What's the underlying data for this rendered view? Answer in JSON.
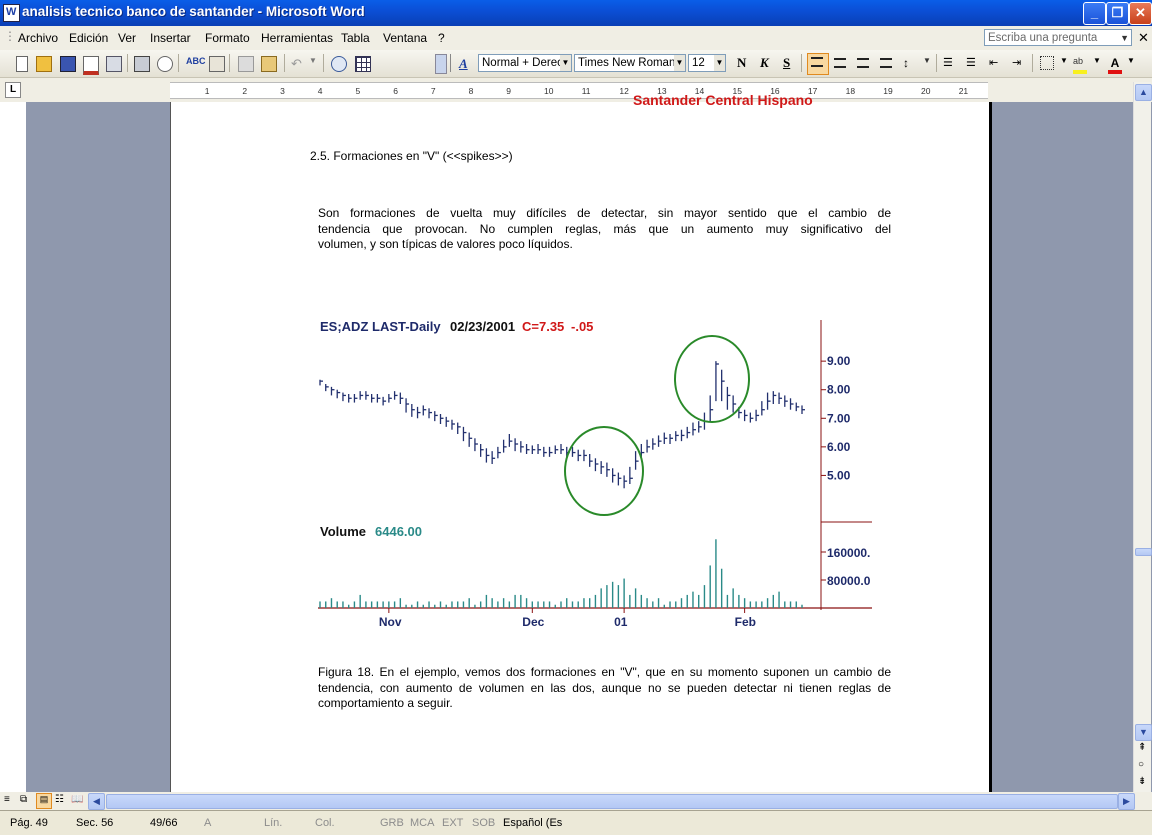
{
  "window": {
    "title": "analisis tecnico banco de santander - Microsoft Word"
  },
  "menu": {
    "items": [
      "Archivo",
      "Edición",
      "Ver",
      "Insertar",
      "Formato",
      "Herramientas",
      "Tabla",
      "Ventana",
      "?"
    ],
    "ask_placeholder": "Escriba una pregunta"
  },
  "toolbar": {
    "style": "Normal + Derec",
    "font": "Times New Roman",
    "size": "12",
    "bold": "N",
    "italic": "K",
    "strike": "S"
  },
  "ruler": {
    "numbers": [
      "1",
      "2",
      "3",
      "4",
      "5",
      "6",
      "7",
      "8",
      "9",
      "10",
      "11",
      "12",
      "13",
      "14",
      "15",
      "16",
      "17",
      "18",
      "19",
      "20",
      "21"
    ]
  },
  "document": {
    "header_fragment": "Santander Central Hispano",
    "heading": "2.5. Formaciones en \"V\" (<<spikes>>)",
    "para1_lines": [
      "Son formaciones de vuelta muy difíciles de detectar, sin mayor sentido que el cambio de",
      "tendencia que provocan.    No cumplen reglas, más que un aumento muy significativo del",
      "volumen, y son típicas de valores poco líquidos."
    ],
    "caption_lines": [
      "Figura 18. En el ejemplo, vemos dos formaciones en \"V\", que en su momento suponen un cambio de",
      "tendencia, con aumento de volumen en las dos, aunque no se pueden detectar ni tienen reglas de",
      "comportamiento a seguir."
    ]
  },
  "chart_data": {
    "type": "bar",
    "title": "ES;ADZ LAST-Daily",
    "date": "02/23/2001",
    "close_label": "C=7.35",
    "change_label": "-.05",
    "price_ticks": [
      "9.00",
      "8.00",
      "7.00",
      "6.00",
      "5.00"
    ],
    "ylim": [
      4.0,
      9.6
    ],
    "volume_title": "Volume",
    "volume_value": "6446.00",
    "volume_ticks": [
      "160000.",
      "80000.0"
    ],
    "x_labels": [
      "Nov",
      "Dec",
      "01",
      "Feb"
    ],
    "colors": {
      "price": "#22306e",
      "volume": "#2a8a88",
      "circle": "#2a8a2a",
      "title": "#1e2a6a",
      "close": "#d01818"
    },
    "price_close": [
      8.3,
      8.1,
      8.0,
      7.9,
      7.8,
      7.7,
      7.7,
      7.8,
      7.8,
      7.7,
      7.7,
      7.6,
      7.7,
      7.8,
      7.7,
      7.5,
      7.3,
      7.2,
      7.3,
      7.2,
      7.1,
      7.0,
      6.9,
      6.8,
      6.7,
      6.5,
      6.3,
      6.1,
      5.9,
      5.7,
      5.6,
      5.8,
      6.0,
      6.2,
      6.1,
      6.0,
      5.9,
      5.9,
      5.9,
      5.8,
      5.8,
      5.9,
      5.9,
      5.8,
      5.8,
      5.7,
      5.7,
      5.5,
      5.4,
      5.3,
      5.2,
      5.0,
      4.9,
      4.8,
      4.9,
      5.5,
      5.8,
      6.0,
      6.1,
      6.2,
      6.3,
      6.3,
      6.4,
      6.4,
      6.5,
      6.6,
      6.7,
      6.9,
      7.3,
      8.9,
      8.3,
      7.8,
      7.5,
      7.2,
      7.1,
      7.0,
      7.1,
      7.3,
      7.6,
      7.8,
      7.7,
      7.6,
      7.5,
      7.4,
      7.3
    ],
    "price_high": [
      8.35,
      8.2,
      8.1,
      8.0,
      7.9,
      7.85,
      7.85,
      7.95,
      7.95,
      7.85,
      7.85,
      7.75,
      7.85,
      7.95,
      7.9,
      7.7,
      7.5,
      7.4,
      7.45,
      7.35,
      7.25,
      7.15,
      7.05,
      6.95,
      6.85,
      6.7,
      6.5,
      6.3,
      6.1,
      5.95,
      5.85,
      6.0,
      6.25,
      6.45,
      6.3,
      6.2,
      6.1,
      6.05,
      6.1,
      6.0,
      6.0,
      6.05,
      6.1,
      6.0,
      6.0,
      5.9,
      5.9,
      5.75,
      5.6,
      5.5,
      5.45,
      5.25,
      5.1,
      5.0,
      5.3,
      5.85,
      6.1,
      6.25,
      6.3,
      6.4,
      6.5,
      6.45,
      6.55,
      6.6,
      6.7,
      6.85,
      6.9,
      7.2,
      7.8,
      9.0,
      8.7,
      8.1,
      7.8,
      7.4,
      7.3,
      7.2,
      7.3,
      7.6,
      7.9,
      7.95,
      7.9,
      7.8,
      7.7,
      7.55,
      7.45
    ],
    "price_low": [
      8.15,
      7.95,
      7.8,
      7.7,
      7.6,
      7.55,
      7.55,
      7.65,
      7.65,
      7.55,
      7.55,
      7.45,
      7.55,
      7.65,
      7.5,
      7.2,
      7.05,
      7.0,
      7.1,
      7.0,
      6.9,
      6.8,
      6.7,
      6.6,
      6.45,
      6.2,
      6.0,
      5.85,
      5.65,
      5.45,
      5.4,
      5.6,
      5.8,
      6.0,
      5.85,
      5.8,
      5.75,
      5.75,
      5.75,
      5.65,
      5.65,
      5.75,
      5.75,
      5.65,
      5.65,
      5.5,
      5.5,
      5.3,
      5.15,
      5.05,
      4.95,
      4.75,
      4.65,
      4.55,
      4.7,
      5.2,
      5.6,
      5.8,
      5.9,
      6.0,
      6.1,
      6.1,
      6.2,
      6.2,
      6.3,
      6.4,
      6.5,
      6.6,
      6.9,
      7.6,
      7.6,
      7.3,
      7.2,
      7.0,
      6.9,
      6.85,
      6.9,
      7.1,
      7.3,
      7.5,
      7.5,
      7.4,
      7.3,
      7.25,
      7.15
    ],
    "volume": [
      2,
      2,
      3,
      2,
      2,
      1,
      2,
      4,
      2,
      2,
      2,
      2,
      2,
      2,
      3,
      1,
      1,
      2,
      1,
      2,
      1,
      2,
      1,
      2,
      2,
      2,
      3,
      1,
      2,
      4,
      3,
      2,
      3,
      2,
      4,
      4,
      3,
      2,
      2,
      2,
      2,
      1,
      2,
      3,
      2,
      2,
      3,
      3,
      4,
      6,
      7,
      8,
      7,
      9,
      4,
      6,
      4,
      3,
      2,
      3,
      1,
      2,
      2,
      3,
      4,
      5,
      4,
      7,
      13,
      21,
      12,
      4,
      6,
      4,
      3,
      2,
      2,
      2,
      3,
      4,
      5,
      2,
      2,
      2,
      1
    ]
  },
  "status": {
    "page": "Pág. 49",
    "sec": "Sec. 56",
    "pages": "49/66",
    "at": "A",
    "lin": "Lín.",
    "col": "Col.",
    "grb": "GRB",
    "mca": "MCA",
    "ext": "EXT",
    "sob": "SOB",
    "lang": "Español (Es"
  }
}
